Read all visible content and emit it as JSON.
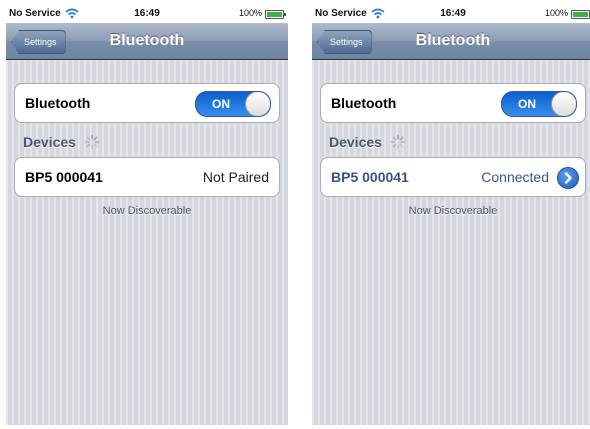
{
  "screens": [
    {
      "status": {
        "carrier": "No Service",
        "time": "16:49",
        "battery": "100%",
        "battery_level": 1.0
      },
      "nav": {
        "back_label": "Settings",
        "title": "Bluetooth"
      },
      "bluetooth_row": {
        "label": "Bluetooth",
        "toggle_label": "ON"
      },
      "devices_header": "Devices",
      "device": {
        "name": "BP5 000041",
        "status": "Not Paired"
      },
      "footer": "Now Discoverable"
    },
    {
      "status": {
        "carrier": "No Service",
        "time": "16:49",
        "battery": "100%",
        "battery_level": 1.0
      },
      "nav": {
        "back_label": "Settings",
        "title": "Bluetooth"
      },
      "bluetooth_row": {
        "label": "Bluetooth",
        "toggle_label": "ON"
      },
      "devices_header": "Devices",
      "device": {
        "name": "BP5 000041",
        "status": "Connected"
      },
      "footer": "Now Discoverable"
    }
  ],
  "colors": {
    "accent_blue": "#385487",
    "toggle_blue": "#0a5fd0",
    "nav_bar": "#7b8eaa",
    "battery_green": "#3cb043"
  },
  "icons": {
    "wifi": "wifi-icon",
    "battery": "battery-icon",
    "spinner": "activity-spinner-icon",
    "disclosure": "detail-disclosure-icon"
  }
}
